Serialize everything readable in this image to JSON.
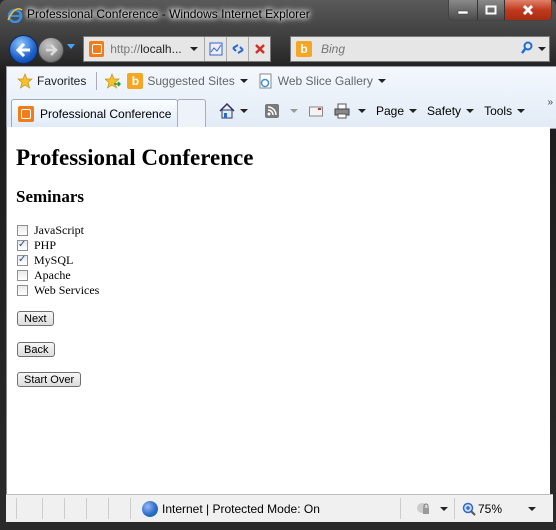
{
  "window": {
    "title": "Professional Conference - Windows Internet Explorer"
  },
  "nav": {
    "address_scheme": "http://",
    "address_host": "localh...",
    "search_placeholder": "Bing"
  },
  "favorites_bar": {
    "favorites_label": "Favorites",
    "suggested_sites_label": "Suggested Sites",
    "web_slice_gallery_label": "Web Slice Gallery"
  },
  "tabs": [
    {
      "label": "Professional Conference",
      "active": true
    }
  ],
  "command_bar": {
    "page_label": "Page",
    "safety_label": "Safety",
    "tools_label": "Tools",
    "overflow_label": "»"
  },
  "page": {
    "title": "Professional Conference",
    "section_title": "Seminars",
    "seminars": [
      {
        "label": "JavaScript",
        "checked": false
      },
      {
        "label": "PHP",
        "checked": true
      },
      {
        "label": "MySQL",
        "checked": true
      },
      {
        "label": "Apache",
        "checked": false
      },
      {
        "label": "Web Services",
        "checked": false
      }
    ],
    "buttons": {
      "next": "Next",
      "back": "Back",
      "start_over": "Start Over"
    }
  },
  "status_bar": {
    "zone_text": "Internet | Protected Mode: On",
    "zoom_level": "75%"
  },
  "colors": {
    "close_button": "#c0391e",
    "addr_icon": "#f07c1a",
    "bing_icon": "#f5a623"
  }
}
